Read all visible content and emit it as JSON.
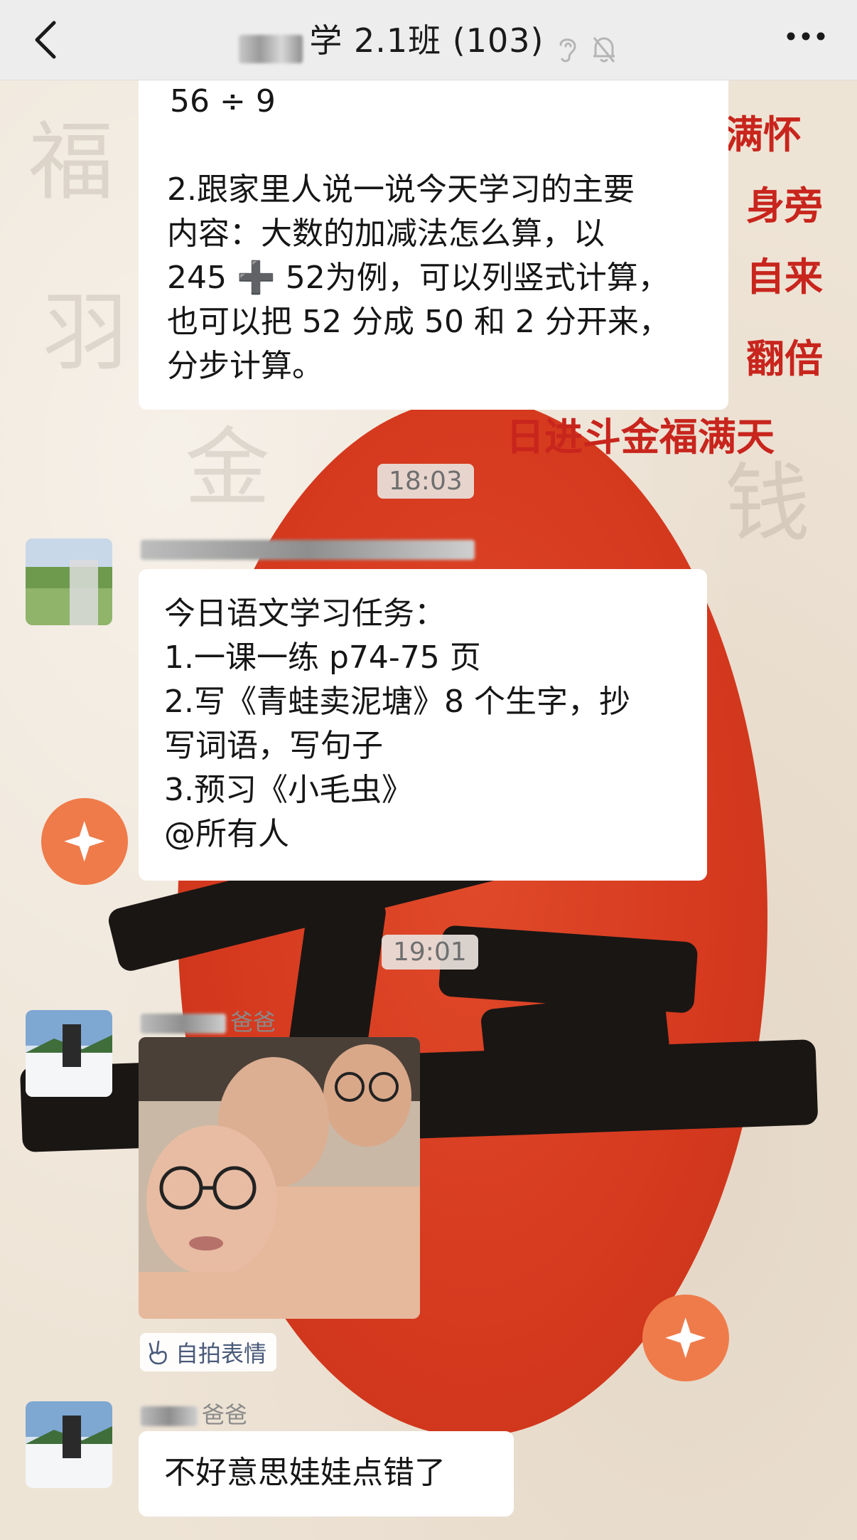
{
  "header": {
    "title": "学 2.1班 (103)",
    "icons": [
      "back-arrow-icon",
      "ear-icon",
      "mute-bell-icon",
      "more-icon"
    ]
  },
  "background_poem": [
    "满怀",
    "身旁",
    "自来",
    "翻倍",
    "日进斗金福满天"
  ],
  "messages": {
    "m1": {
      "lines": [
        "56 ÷ 9",
        "",
        "2.跟家里人说一说今天学习的主要",
        "内容：大数的加减法怎么算，以",
        "245 ➕ 52为例，可以列竖式计算，",
        "也可以把 52 分成 50 和 2 分开来，",
        "分步计算。"
      ]
    },
    "t1": "18:03",
    "m2": {
      "lines": [
        "今日语文学习任务：",
        "1.一课一练 p74-75 页",
        "2.写《青蛙卖泥塘》8 个生字，抄",
        "写词语，写句子",
        "3.预习《小毛虫》",
        "@所有人"
      ]
    },
    "t2": "19:01",
    "m3": {
      "nickname": "爸爸",
      "tag": "自拍表情"
    },
    "m4": {
      "nickname": "爸爸",
      "text": "不好意思娃娃点错了"
    }
  },
  "colors": {
    "header_bg": "#ededed",
    "bubble_bg": "#ffffff",
    "accent_red": "#d63a1f"
  }
}
